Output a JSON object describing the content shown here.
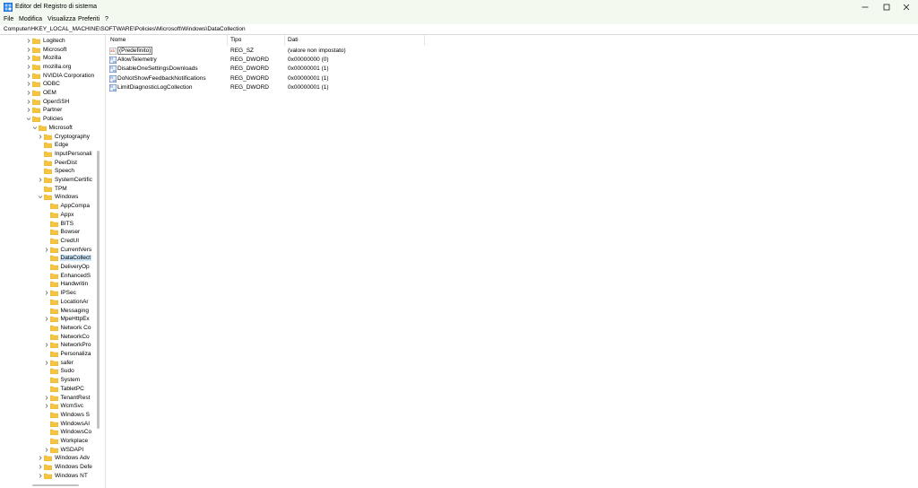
{
  "window": {
    "title": "Editor del Registro di sistema"
  },
  "menu": [
    "File",
    "Modifica",
    "Visualizza",
    "Preferiti",
    "?"
  ],
  "address": "Computer\\HKEY_LOCAL_MACHINE\\SOFTWARE\\Policies\\Microsoft\\Windows\\DataCollection",
  "tree": [
    {
      "label": "Logitech",
      "depth": 0,
      "chevron": "right"
    },
    {
      "label": "Microsoft",
      "depth": 0,
      "chevron": "right"
    },
    {
      "label": "Mozilla",
      "depth": 0,
      "chevron": "right"
    },
    {
      "label": "mozilla.org",
      "depth": 0,
      "chevron": "right"
    },
    {
      "label": "NVIDIA Corporation",
      "depth": 0,
      "chevron": "right"
    },
    {
      "label": "ODBC",
      "depth": 0,
      "chevron": "right"
    },
    {
      "label": "OEM",
      "depth": 0,
      "chevron": "right"
    },
    {
      "label": "OpenSSH",
      "depth": 0,
      "chevron": "right"
    },
    {
      "label": "Partner",
      "depth": 0,
      "chevron": "right"
    },
    {
      "label": "Policies",
      "depth": 0,
      "chevron": "down"
    },
    {
      "label": "Microsoft",
      "depth": 1,
      "chevron": "down"
    },
    {
      "label": "Cryptography",
      "depth": 2,
      "chevron": "right"
    },
    {
      "label": "Edge",
      "depth": 2,
      "chevron": "none"
    },
    {
      "label": "InputPersonali",
      "depth": 2,
      "chevron": "none"
    },
    {
      "label": "PeerDist",
      "depth": 2,
      "chevron": "none"
    },
    {
      "label": "Speech",
      "depth": 2,
      "chevron": "none"
    },
    {
      "label": "SystemCertific",
      "depth": 2,
      "chevron": "right"
    },
    {
      "label": "TPM",
      "depth": 2,
      "chevron": "none"
    },
    {
      "label": "Windows",
      "depth": 2,
      "chevron": "down"
    },
    {
      "label": "AppCompa",
      "depth": 3,
      "chevron": "none"
    },
    {
      "label": "Appx",
      "depth": 3,
      "chevron": "none"
    },
    {
      "label": "BITS",
      "depth": 3,
      "chevron": "none"
    },
    {
      "label": "Bowser",
      "depth": 3,
      "chevron": "none"
    },
    {
      "label": "CredUI",
      "depth": 3,
      "chevron": "none"
    },
    {
      "label": "CurrentVers",
      "depth": 3,
      "chevron": "right"
    },
    {
      "label": "DataCollect",
      "depth": 3,
      "chevron": "none",
      "selected": true
    },
    {
      "label": "DeliveryOp",
      "depth": 3,
      "chevron": "none"
    },
    {
      "label": "EnhancedS",
      "depth": 3,
      "chevron": "none"
    },
    {
      "label": "Handwritin",
      "depth": 3,
      "chevron": "none"
    },
    {
      "label": "IPSec",
      "depth": 3,
      "chevron": "right"
    },
    {
      "label": "LocationAr",
      "depth": 3,
      "chevron": "none"
    },
    {
      "label": "Messaging",
      "depth": 3,
      "chevron": "none"
    },
    {
      "label": "MpeHttpEx",
      "depth": 3,
      "chevron": "right"
    },
    {
      "label": "Network Co",
      "depth": 3,
      "chevron": "none"
    },
    {
      "label": "NetworkCo",
      "depth": 3,
      "chevron": "none"
    },
    {
      "label": "NetworkPro",
      "depth": 3,
      "chevron": "right"
    },
    {
      "label": "Personaliza",
      "depth": 3,
      "chevron": "none"
    },
    {
      "label": "safer",
      "depth": 3,
      "chevron": "right"
    },
    {
      "label": "Sudo",
      "depth": 3,
      "chevron": "none"
    },
    {
      "label": "System",
      "depth": 3,
      "chevron": "none"
    },
    {
      "label": "TabletPC",
      "depth": 3,
      "chevron": "none"
    },
    {
      "label": "TenantRest",
      "depth": 3,
      "chevron": "right"
    },
    {
      "label": "WcmSvc",
      "depth": 3,
      "chevron": "right"
    },
    {
      "label": "Windows S",
      "depth": 3,
      "chevron": "none"
    },
    {
      "label": "WindowsAI",
      "depth": 3,
      "chevron": "none"
    },
    {
      "label": "WindowsCo",
      "depth": 3,
      "chevron": "none"
    },
    {
      "label": "Workplace",
      "depth": 3,
      "chevron": "none"
    },
    {
      "label": "WSDAPI",
      "depth": 3,
      "chevron": "right"
    },
    {
      "label": "Windows Adv",
      "depth": 2,
      "chevron": "right"
    },
    {
      "label": "Windows Defe",
      "depth": 2,
      "chevron": "right"
    },
    {
      "label": "Windows NT",
      "depth": 2,
      "chevron": "right"
    }
  ],
  "columns": {
    "name": "Nome",
    "type": "Tipo",
    "data": "Dati"
  },
  "values": [
    {
      "name": "(Predefinito)",
      "type": "REG_SZ",
      "data": "(valore non impostato)",
      "icon": "string",
      "focused": true
    },
    {
      "name": "AllowTelemetry",
      "type": "REG_DWORD",
      "data": "0x00000000 (0)",
      "icon": "binary"
    },
    {
      "name": "DisableOneSettingsDownloads",
      "type": "REG_DWORD",
      "data": "0x00000001 (1)",
      "icon": "binary"
    },
    {
      "name": "DoNotShowFeedbackNotifications",
      "type": "REG_DWORD",
      "data": "0x00000001 (1)",
      "icon": "binary"
    },
    {
      "name": "LimitDiagnosticLogCollection",
      "type": "REG_DWORD",
      "data": "0x00000001 (1)",
      "icon": "binary"
    }
  ],
  "colors": {
    "titlebar": "#f3f9ef",
    "selection": "#cce4f7",
    "folder": "#f5c542"
  }
}
